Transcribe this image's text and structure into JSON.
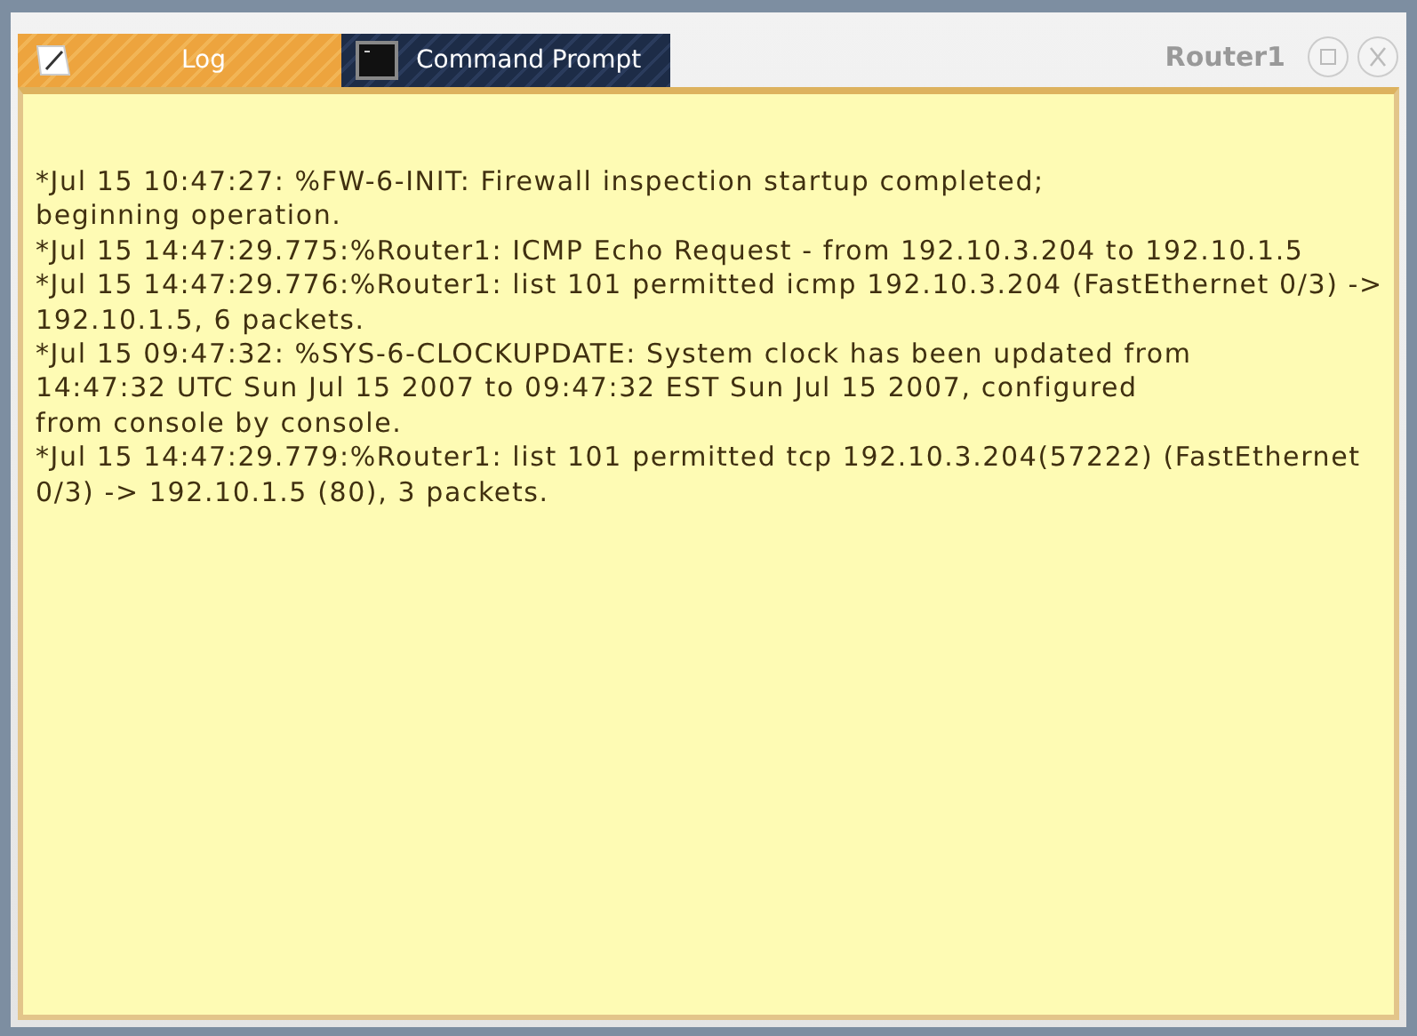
{
  "tabs": [
    {
      "label": "Log",
      "kind": "log",
      "selected": true
    },
    {
      "label": "Command Prompt",
      "kind": "terminal",
      "selected": false
    }
  ],
  "window": {
    "title": "Router1"
  },
  "log_lines": [
    "*Jul 15 10:47:27: %FW-6-INIT: Firewall inspection startup completed;",
    "beginning operation.",
    "*Jul 15 14:47:29.775:%Router1: ICMP Echo Request - from 192.10.3.204 to 192.10.1.5",
    "*Jul 15 14:47:29.776:%Router1: list 101 permitted icmp 192.10.3.204 (FastEthernet 0/3) ->",
    "192.10.1.5, 6 packets.",
    "*Jul 15 09:47:32: %SYS-6-CLOCKUPDATE: System clock has been updated from",
    "14:47:32 UTC Sun Jul 15 2007 to 09:47:32 EST Sun Jul 15 2007, configured",
    "from console by console.",
    "*Jul 15 14:47:29.779:%Router1: list 101 permitted tcp 192.10.3.204(57222) (FastEthernet",
    "0/3) -> 192.10.1.5 (80), 3 packets."
  ]
}
